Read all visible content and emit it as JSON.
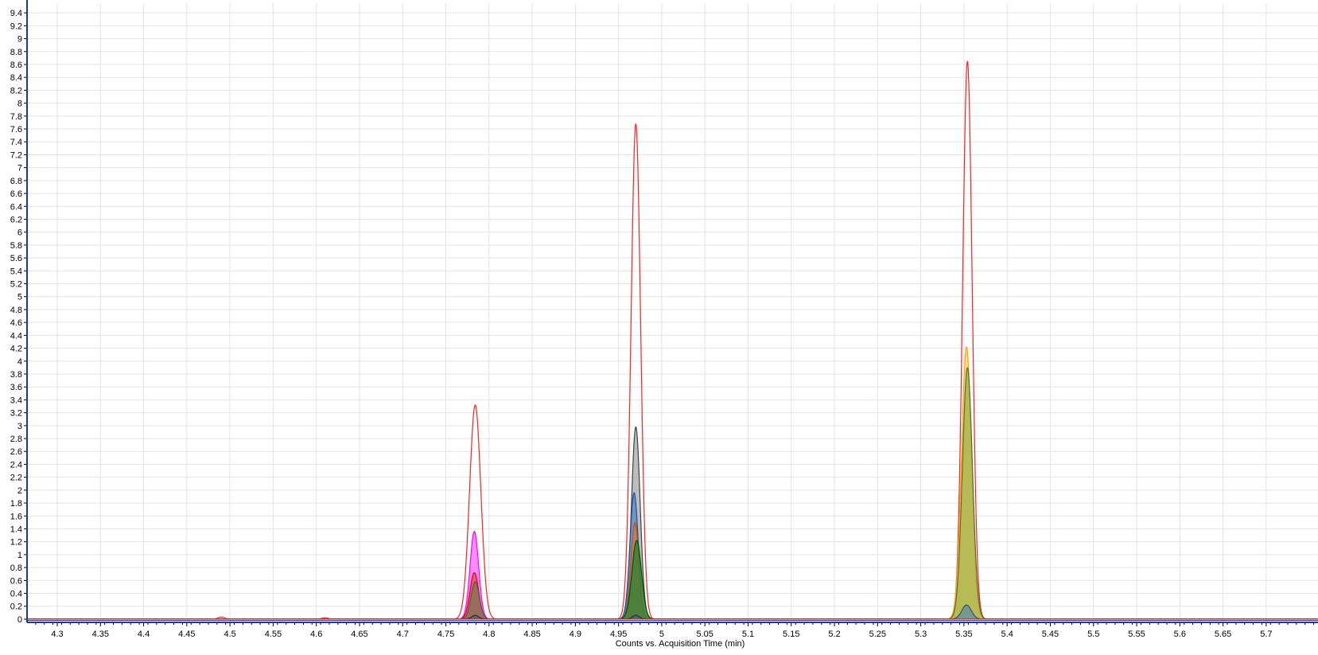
{
  "chart_data": {
    "type": "area",
    "title": "",
    "xlabel": "Counts vs. Acquisition Time (min)",
    "ylabel": "",
    "xlim": [
      4.265,
      5.76
    ],
    "ylim": [
      -0.05,
      9.55
    ],
    "grid": true,
    "legend": "none",
    "x_ticks": [
      "4.3",
      "4.35",
      "4.4",
      "4.45",
      "4.5",
      "4.55",
      "4.6",
      "4.65",
      "4.7",
      "4.75",
      "4.8",
      "4.85",
      "4.9",
      "4.95",
      "5",
      "5.05",
      "5.1",
      "5.15",
      "5.2",
      "5.25",
      "5.3",
      "5.35",
      "5.4",
      "5.45",
      "5.5",
      "5.55",
      "5.6",
      "5.65",
      "5.7"
    ],
    "y_ticks": [
      "0",
      "0.2",
      "0.4",
      "0.6",
      "0.8",
      "1",
      "1.2",
      "1.4",
      "1.6",
      "1.8",
      "2",
      "2.2",
      "2.4",
      "2.6",
      "2.8",
      "3",
      "3.2",
      "3.4",
      "3.6",
      "3.8",
      "4",
      "4.2",
      "4.4",
      "4.6",
      "4.8",
      "5",
      "5.2",
      "5.4",
      "5.6",
      "5.8",
      "6",
      "6.2",
      "6.4",
      "6.6",
      "6.8",
      "7",
      "7.2",
      "7.4",
      "7.6",
      "7.8",
      "8",
      "8.2",
      "8.4",
      "8.6",
      "8.8",
      "9",
      "9.2",
      "9.4"
    ],
    "series": [
      {
        "color": "#ff2020",
        "fill": "none",
        "peaks": [
          {
            "rt": 4.784,
            "height": 3.32,
            "width": 0.0065
          },
          {
            "rt": 4.97,
            "height": 7.68,
            "width": 0.0055
          },
          {
            "rt": 5.354,
            "height": 8.65,
            "width": 0.0055
          },
          {
            "rt": 4.49,
            "height": 0.03,
            "width": 0.004
          },
          {
            "rt": 4.61,
            "height": 0.02,
            "width": 0.004
          }
        ]
      },
      {
        "color": "#ff00ff",
        "fill": "#ff66ff",
        "peaks": [
          {
            "rt": 4.783,
            "height": 1.36,
            "width": 0.005
          }
        ]
      },
      {
        "color": "#e00000",
        "fill": "#e05050",
        "peaks": [
          {
            "rt": 4.783,
            "height": 0.72,
            "width": 0.005
          }
        ]
      },
      {
        "color": "#506030",
        "fill": "#807050",
        "peaks": [
          {
            "rt": 4.784,
            "height": 0.58,
            "width": 0.0048
          }
        ]
      },
      {
        "color": "#404040",
        "fill": "#a8a8a8",
        "peaks": [
          {
            "rt": 4.97,
            "height": 2.98,
            "width": 0.005
          }
        ]
      },
      {
        "color": "#1f4fa0",
        "fill": "#5b84c4",
        "peaks": [
          {
            "rt": 4.968,
            "height": 1.96,
            "width": 0.0048
          }
        ]
      },
      {
        "color": "#c05000",
        "fill": "#c08050",
        "peaks": [
          {
            "rt": 4.969,
            "height": 1.5,
            "width": 0.0046
          }
        ]
      },
      {
        "color": "#005000",
        "fill": "#2e7d2e",
        "peaks": [
          {
            "rt": 4.971,
            "height": 1.22,
            "width": 0.0055
          }
        ]
      },
      {
        "color": "#ffa500",
        "fill": "#ffd070",
        "peaks": [
          {
            "rt": 5.353,
            "height": 4.22,
            "width": 0.0058
          }
        ]
      },
      {
        "color": "#556b2f",
        "fill": "#a0b040",
        "peaks": [
          {
            "rt": 5.354,
            "height": 3.9,
            "width": 0.0058
          }
        ]
      },
      {
        "color": "#2f4f6f",
        "fill": "#5f8fa0",
        "peaks": [
          {
            "rt": 5.353,
            "height": 0.22,
            "width": 0.0055
          }
        ]
      },
      {
        "color": "#203040",
        "fill": "#506070",
        "peaks": [
          {
            "rt": 4.784,
            "height": 0.06,
            "width": 0.004
          },
          {
            "rt": 4.97,
            "height": 0.06,
            "width": 0.004
          }
        ]
      }
    ]
  }
}
